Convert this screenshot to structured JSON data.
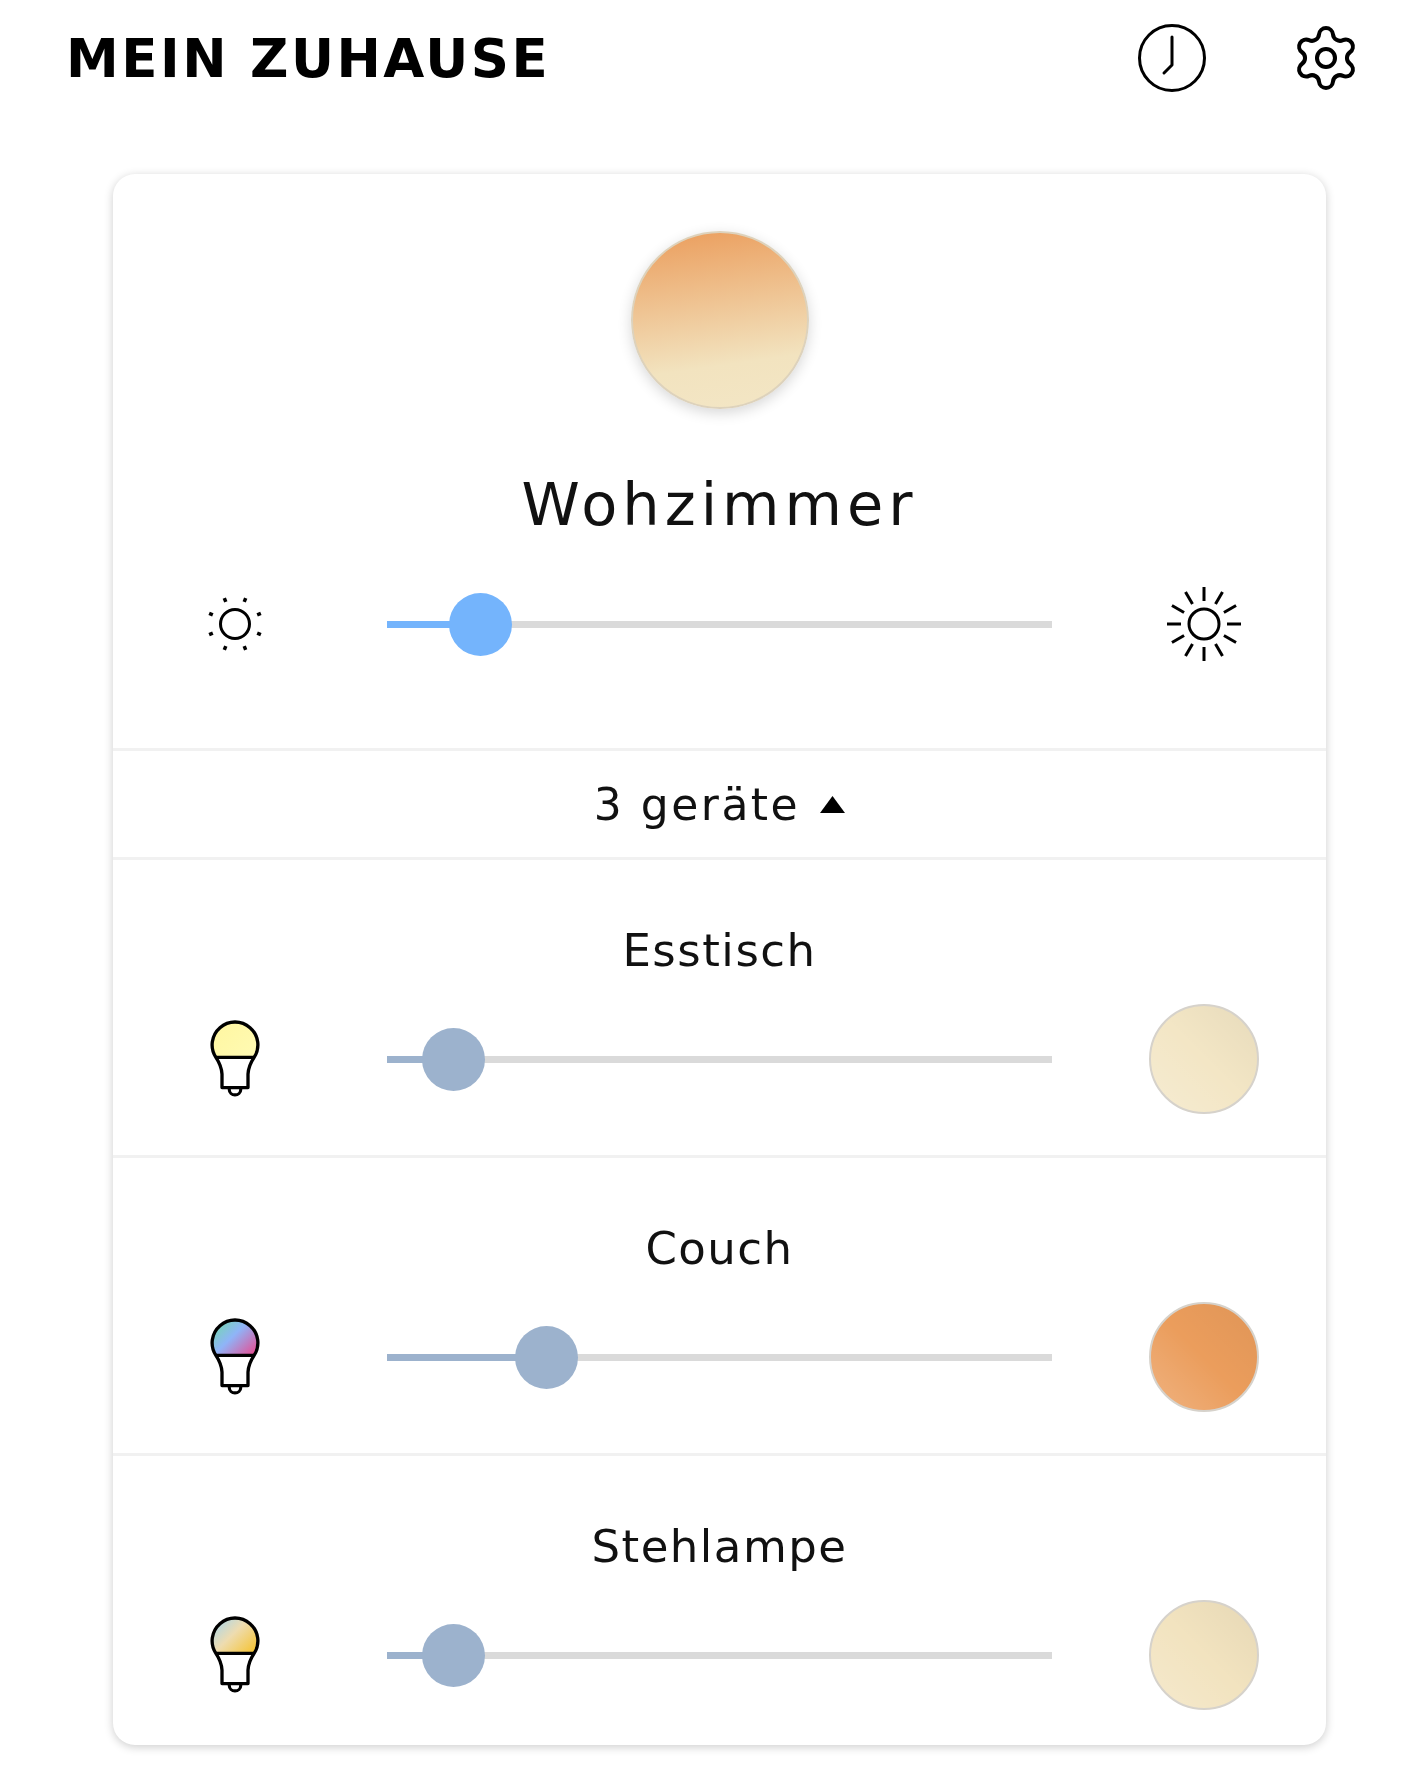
{
  "header": {
    "title": "MEIN ZUHAUSE"
  },
  "room": {
    "name": "Wohzimmer",
    "level": 0.14
  },
  "devices_toggle": {
    "label": "3 geräte",
    "expanded": true
  },
  "devices": [
    {
      "name": "Esstisch",
      "kind": "white",
      "level": 0.1,
      "color": "#f3e6c5"
    },
    {
      "name": "Couch",
      "kind": "color",
      "level": 0.24,
      "color": "#eb9d5c"
    },
    {
      "name": "Stehlampe",
      "kind": "ambiance",
      "level": 0.1,
      "color": "#f2e3bf"
    }
  ]
}
